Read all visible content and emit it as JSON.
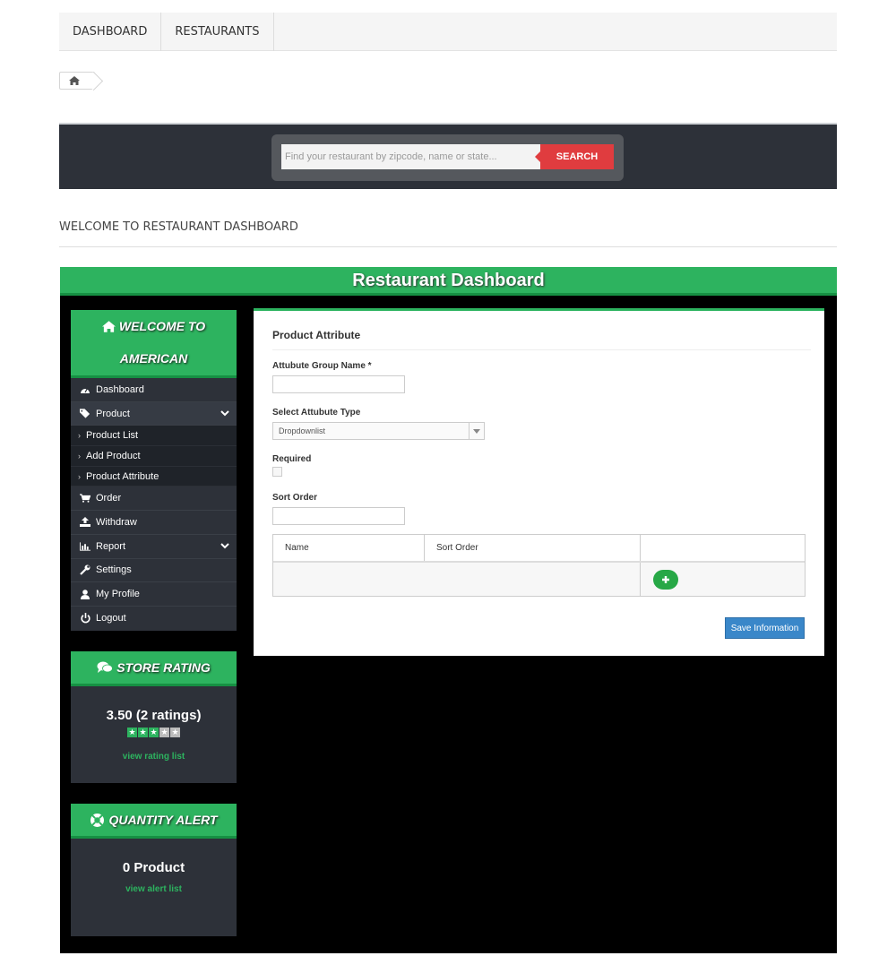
{
  "topnav": {
    "items": [
      "DASHBOARD",
      "RESTAURANTS"
    ]
  },
  "breadcrumb": {
    "icon": "home-icon"
  },
  "search": {
    "placeholder": "Find your restaurant by zipcode, name or state...",
    "button": "SEARCH"
  },
  "welcome_heading": "WELCOME TO RESTAURANT DASHBOARD",
  "dashboard": {
    "title": "Restaurant Dashboard",
    "welcome_box": {
      "line1": "WELCOME TO",
      "line2": "AMERICAN",
      "icon": "home-icon"
    },
    "menu": {
      "dashboard": "Dashboard",
      "product": "Product",
      "product_list": "Product List",
      "add_product": "Add Product",
      "product_attribute": "Product Attribute",
      "order": "Order",
      "withdraw": "Withdraw",
      "report": "Report",
      "settings": "Settings",
      "my_profile": "My Profile",
      "logout": "Logout"
    },
    "rating": {
      "title": "STORE RATING",
      "value": "3.50 (2 ratings)",
      "stars": 3.5,
      "link": "view rating list",
      "icon": "comments-icon"
    },
    "alert": {
      "title": "QUANTITY ALERT",
      "value": "0 Product",
      "link": "view alert list",
      "icon": "lifebuoy-icon"
    }
  },
  "form": {
    "title": "Product Attribute",
    "group_label": "Attubute Group Name *",
    "group_value": "",
    "type_label": "Select Attubute Type",
    "type_value": "Dropdownlist",
    "required_label": "Required",
    "required_checked": false,
    "sort_label": "Sort Order",
    "sort_value": "",
    "table_headers": [
      "Name",
      "Sort Order",
      ""
    ],
    "save": "Save Information"
  },
  "colors": {
    "green": "#2db35f",
    "dark": "#2d3139",
    "red": "#e03c3f",
    "blue": "#3a87c9"
  }
}
